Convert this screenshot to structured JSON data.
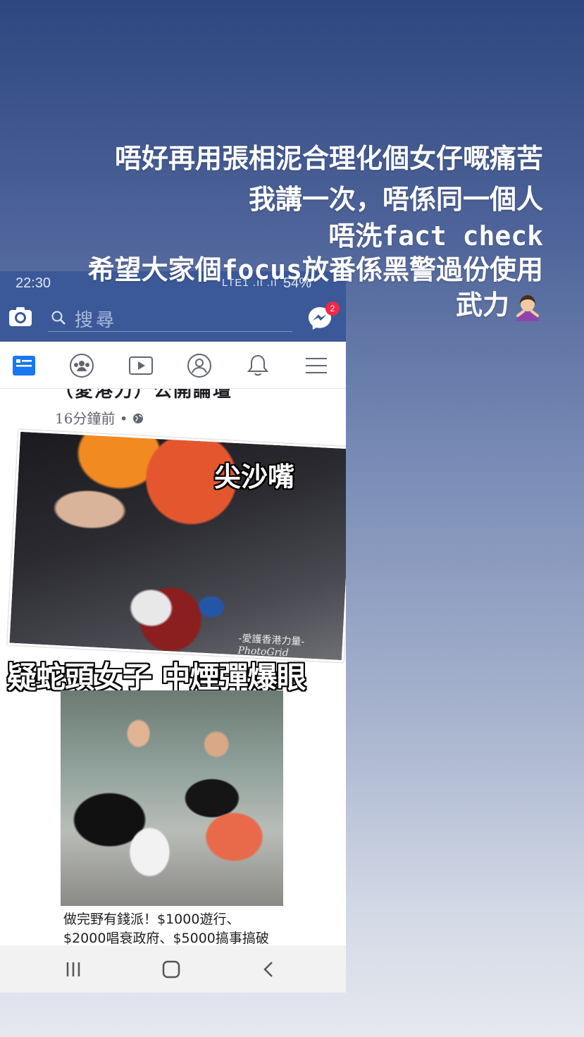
{
  "story_caption": {
    "line1": "唔好再用張相泥合理化個女仔嘅痛苦",
    "line2": "我講一次，唔係同一個人",
    "line3_cn": "唔洗",
    "line3_en": "fact check",
    "line4_a": "希望大家個",
    "line4_en": "focus",
    "line4_b": "放番係黑警過份使用",
    "line5": "武力",
    "emoji": "woman-gesturing-no-emoji"
  },
  "status_bar": {
    "time": "22:30",
    "signal": "LTE1 .ıl .ıl",
    "battery": "54%"
  },
  "fb_header": {
    "search_placeholder": "搜尋",
    "messenger_badge": "2"
  },
  "nav_icons": [
    "news-feed-icon",
    "groups-icon",
    "watch-icon",
    "profile-icon",
    "notifications-icon",
    "menu-icon"
  ],
  "post": {
    "page_name": "（愛港力）公開論壇",
    "time": "16分鐘前 •",
    "image1_location": "尖沙嘴",
    "image1_watermark": "-愛護香港力量-",
    "image1_watermark2": "PhotoGrid",
    "image1_caption": "疑蛇頭女子 中煙彈爆眼",
    "link_title_line1": "做完野有錢派！$1000遊行、",
    "link_title_line2": "$2000唱衰政府、$5000搞事搞破"
  },
  "colors": {
    "facebook_blue": "#3b5998",
    "badge_red": "#f02849"
  }
}
